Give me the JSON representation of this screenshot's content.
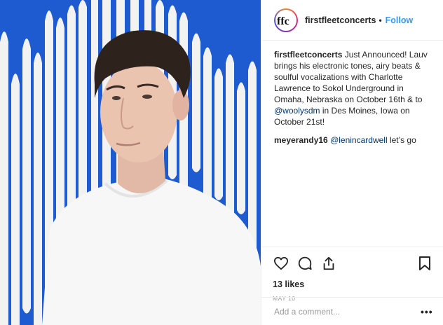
{
  "post": {
    "account": {
      "username": "firstfleetconcerts",
      "follow_label": "Follow",
      "separator": "•",
      "avatar_text": "ffc"
    },
    "caption": {
      "username": "firstfleetconcerts",
      "text_part1": "Just Announced! Lauv brings his electronic tones, airy beats & soulful vocalizations with Charlotte Lawrence to Sokol Underground in Omaha, Nebraska on October 16th & to",
      "mention": "@woolysdm",
      "text_part2": "in Des Moines, Iowa on October 21st!"
    },
    "comments": [
      {
        "username": "meyerandy16",
        "mention": "@lenincardwell",
        "text": "let’s go"
      }
    ],
    "actions": {
      "like_icon": "heart-icon",
      "comment_icon": "comment-icon",
      "share_icon": "share-icon",
      "save_icon": "bookmark-icon"
    },
    "likes_text": "13 likes",
    "date_text": "MAY 10",
    "add_comment_placeholder": "Add a comment...",
    "more_label": "•••"
  },
  "colors": {
    "link": "#3897f0",
    "mention": "#003569",
    "muted": "#999999",
    "photo_background": "#1f5bd0"
  }
}
